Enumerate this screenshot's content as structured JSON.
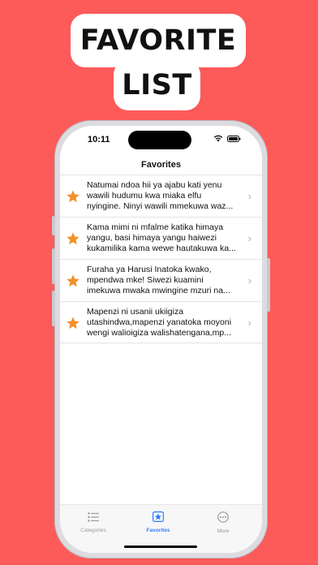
{
  "headline": {
    "line1": "FAVORITE",
    "line2": "LIST"
  },
  "status_bar": {
    "time": "10:11"
  },
  "nav": {
    "title": "Favorites"
  },
  "favorites": [
    {
      "text": "Natumai ndoa hii ya ajabu kati yenu wawili hudumu kwa miaka elfu nyingine. Ninyi wawili mmekuwa waz..."
    },
    {
      "text": "Kama mimi ni mfalme katika himaya yangu, basi himaya yangu haiwezi kukamilika kama wewe hautakuwa ka..."
    },
    {
      "text": "Furaha ya Harusi Inatoka kwako, mpendwa mke! Siwezi kuamini imekuwa mwaka mwingine mzuri na..."
    },
    {
      "text": "Mapenzi ni usanii ukiigiza utashindwa,mapenzi yanatoka moyoni wengi walioigiza walishatengana,mp..."
    }
  ],
  "tabs": [
    {
      "label": "Categories",
      "icon": "list-icon",
      "active": false
    },
    {
      "label": "Favorites",
      "icon": "star-icon",
      "active": true
    },
    {
      "label": "More",
      "icon": "more-icon",
      "active": false
    }
  ],
  "colors": {
    "background": "#fd5a5a",
    "star": "#f0922c",
    "accent": "#2f7bff"
  }
}
